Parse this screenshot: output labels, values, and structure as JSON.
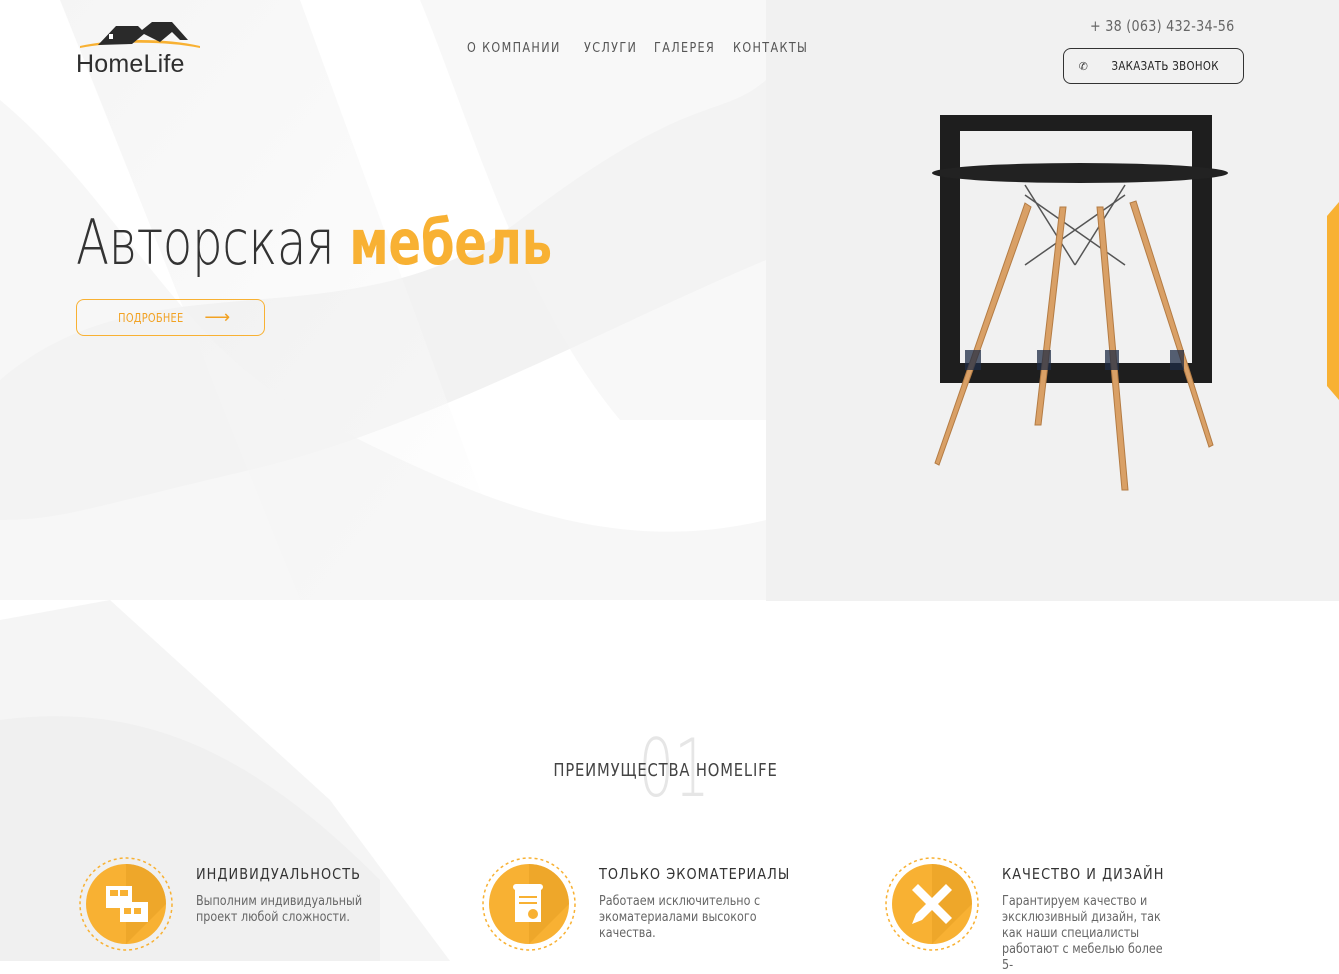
{
  "brand": {
    "name": "HomeLife",
    "accent_color": "#f8b133",
    "logo_icon": "house-roof-icon"
  },
  "nav": {
    "items": [
      "О КОМПАНИИ",
      "УСЛУГИ",
      "ГАЛЕРЕЯ",
      "КОНТАКТЫ"
    ]
  },
  "contact": {
    "phone": "+ 38 (063) 432-34-56",
    "callback_label": "ЗАКАЗАТЬ ЗВОНОК",
    "callback_icon": "phone-icon"
  },
  "hero": {
    "title_main": "Авторская",
    "title_accent": "мебель",
    "button_label": "ПОДРОБНЕЕ",
    "button_icon": "arrow-right-icon",
    "image": "round-table-image"
  },
  "advantages": {
    "number": "01",
    "title": "ПРЕИМУЩЕСТВА HOMELIFE",
    "items": [
      {
        "heading": "ИНДИВИДУАЛЬНОСТЬ",
        "text": "Выполним индивидуальный проект любой сложности.",
        "icon": "blueprint-layout-icon"
      },
      {
        "heading": "ТОЛЬКО ЭКОМАТЕРИАЛЫ",
        "text": "Работаем исключительно с экоматериалами высокого качества.",
        "icon": "certificate-scroll-icon"
      },
      {
        "heading": "КАЧЕСТВО И ДИЗАЙН",
        "text": "Гарантируем качество и эксклюзивный дизайн, так как наши специалисты работают с мебелью более 5-",
        "icon": "pencil-ruler-icon"
      }
    ]
  }
}
